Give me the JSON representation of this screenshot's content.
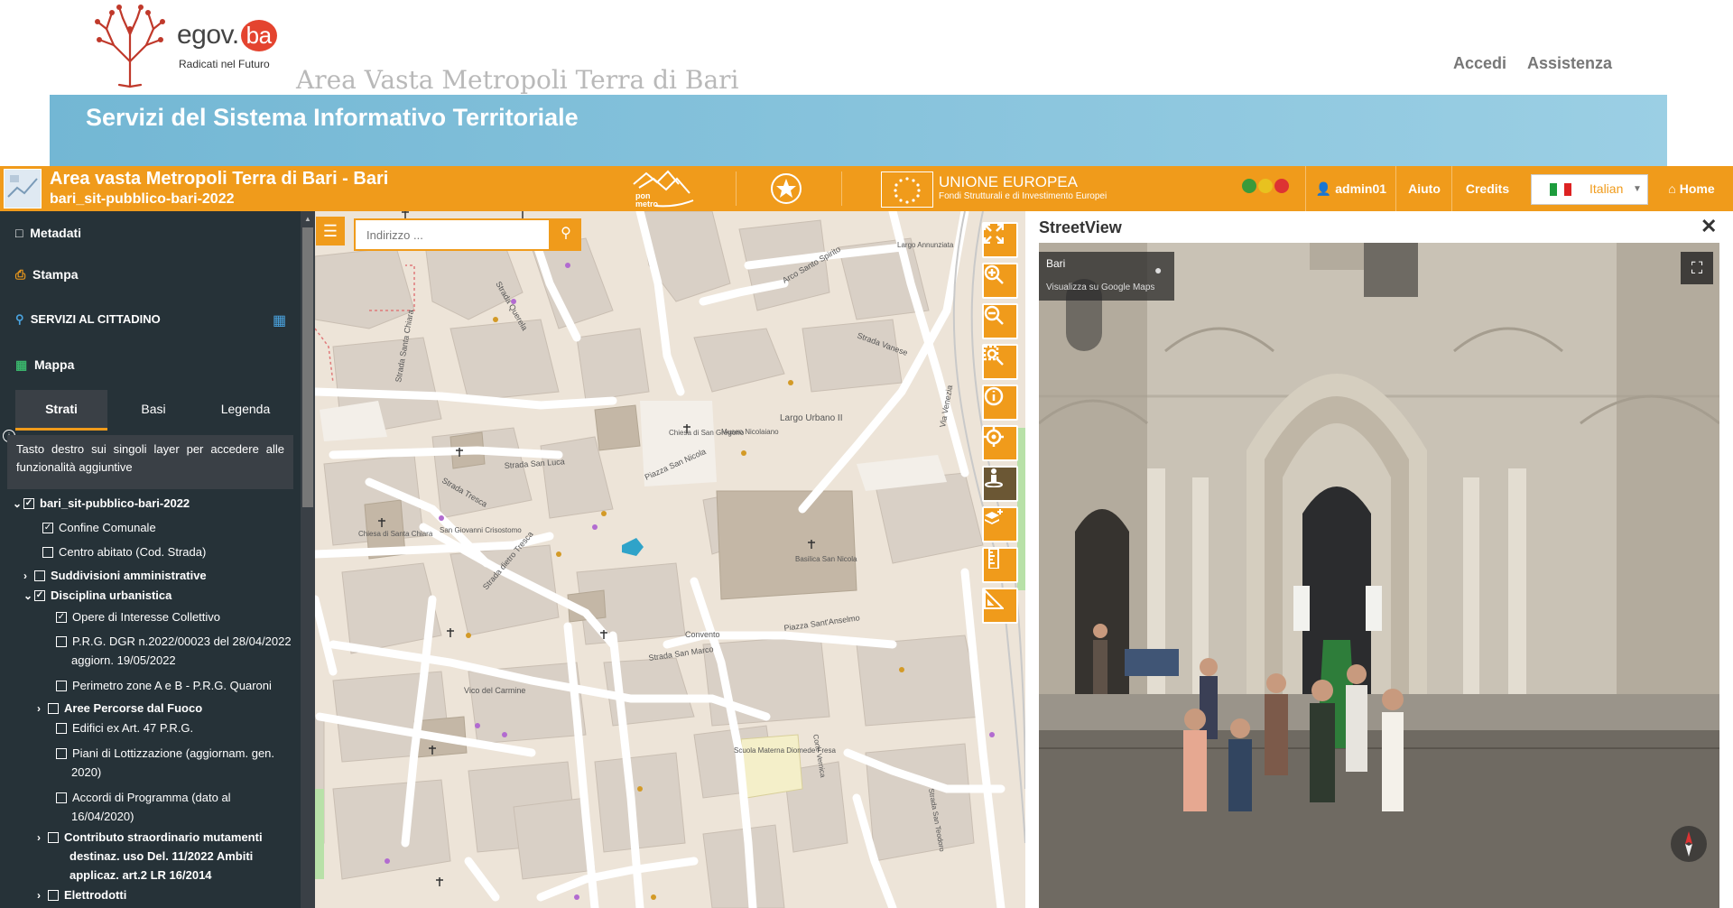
{
  "header": {
    "logo_word": "egov.",
    "logo_badge": "ba",
    "logo_tagline": "Radicati nel Futuro",
    "area_title": "Area Vasta Metropoli Terra di Bari",
    "links": {
      "login": "Accedi",
      "help": "Assistenza"
    },
    "banner_title": "Servizi del Sistema Informativo Territoriale"
  },
  "appbar": {
    "title": "Area vasta Metropoli Terra di Bari - Bari",
    "subtitle": "bari_sit-pubblico-bari-2022",
    "ponmetro": "pon metro",
    "eu_title": "UNIONE EUROPEA",
    "eu_sub": "Fondi Strutturali e di Investimento Europei",
    "user": "admin01",
    "aiuto": "Aiuto",
    "credits": "Credits",
    "language": "Italian",
    "home": "Home",
    "accent": "#f09b1b"
  },
  "sidebar": {
    "metadati": "Metadati",
    "stampa": "Stampa",
    "servizi": "SERVIZI AL CITTADINO",
    "mappa": "Mappa",
    "tabs": [
      "Strati",
      "Basi",
      "Legenda"
    ],
    "tip": "Tasto destro sui singoli layer per accedere alle funzionalità aggiuntive",
    "layers": [
      {
        "label": "bari_sit-pubblico-bari-2022",
        "checked": true,
        "bold": true,
        "expanded": true
      },
      {
        "label": "Confine Comunale",
        "checked": true
      },
      {
        "label": "Centro abitato (Cod. Strada)",
        "checked": false
      },
      {
        "label": "Suddivisioni amministrative",
        "checked": false,
        "bold": true,
        "expanded": false
      },
      {
        "label": "Disciplina urbanistica",
        "checked": true,
        "bold": true,
        "expanded": true
      },
      {
        "label": "Opere di Interesse Collettivo",
        "checked": true
      },
      {
        "label": "P.R.G. DGR n.2022/00023 del 28/04/2022",
        "label2": "aggiorn. 19/05/2022",
        "checked": false
      },
      {
        "label": "Perimetro zone A e B - P.R.G. Quaroni",
        "checked": false
      },
      {
        "label": "Aree Percorse dal Fuoco",
        "checked": false,
        "bold": true,
        "expanded": false
      },
      {
        "label": "Edifici ex Art. 47 P.R.G.",
        "checked": false
      },
      {
        "label": "Piani di Lottizzazione (aggiornam. gen.",
        "label2": "2020)",
        "checked": false
      },
      {
        "label": "Accordi di Programma (dato al",
        "label2": "16/04/2020)",
        "checked": false
      },
      {
        "label": "Contributo straordinario mutamenti",
        "label2": "destinaz. uso Del. 11/2022 Ambiti",
        "label3": "applicaz. art.2 LR 16/2014",
        "checked": false,
        "bold": true,
        "expanded": false
      },
      {
        "label": "Elettrodotti",
        "checked": false,
        "bold": true,
        "expanded": false
      }
    ]
  },
  "map": {
    "search_placeholder": "Indirizzo ...",
    "labels": {
      "largo_urbano": "Largo Urbano II",
      "piazza_sn": "Piazza San Nicola",
      "piazza_sn2": "Piazza\nSan\nNicola",
      "strada_san_luca": "Strada San Luca",
      "strada_santa_chiara": "Strada Santa Chiara",
      "strada_tresca": "Strada Tresca",
      "strada_dietro_tresca": "Strada dietro Tresca",
      "strada_san_marco": "Strada San Marco",
      "vico_carmine": "Vico del Carmine",
      "piazza_santanselmo": "Piazza Sant'Anselmo",
      "strada_vanese": "Strada Vanese",
      "arco_santo_spirito": "Arco Santo Spirito",
      "largo_annunziata": "Largo Annunziata",
      "corte_vernica": "Corte Vernica",
      "strada_san_teodoro": "Strada San Teodoro",
      "basilica": "Basilica San Nicola",
      "chiesa_gregorio": "Chiesa di San Gregorio",
      "convento": "Convento",
      "museo": "Museo Nicolaiano",
      "scuola": "Scuola Materna Diomede Fresa",
      "chiesa_chiara": "Chiesa di Santa Chiara",
      "san_giovanni": "San Giovanni Crisostomo",
      "strada_querela": "Strada Querela",
      "via_venezia": "Via Venezia",
      "strada_chiara2": "Strada Santa Chiara"
    }
  },
  "streetview": {
    "title": "StreetView",
    "place": "Bari",
    "link": "Visualizza su Google Maps"
  }
}
